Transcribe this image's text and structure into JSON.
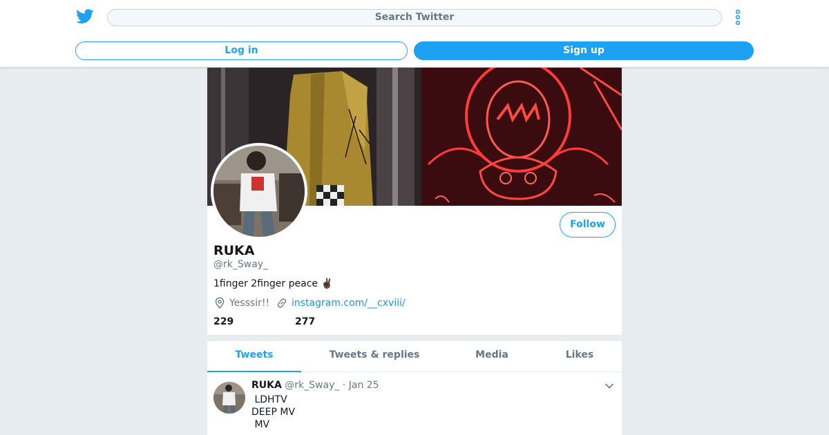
{
  "colors": {
    "accent": "#1da1f2",
    "link": "#1b95e0",
    "muted": "#657786",
    "background": "#e6ecf0"
  },
  "header": {
    "logo_icon": "twitter-bird-icon",
    "search_placeholder": "Search Twitter",
    "more_icon": "vertical-ellipsis-icon",
    "login_label": "Log in",
    "signup_label": "Sign up"
  },
  "profile": {
    "follow_label": "Follow",
    "name": "RUKA",
    "handle": "@rk_Sway_",
    "bio": "1finger 2finger peace ✌🏿",
    "location": "Yesssir!!",
    "location_icon": "location-pin-icon",
    "website": "instagram.com/__cxviii/",
    "link_icon": "link-icon",
    "stats": {
      "following": "229",
      "followers": "277"
    }
  },
  "tabs": [
    {
      "label": "Tweets",
      "active": true
    },
    {
      "label": "Tweets & replies",
      "active": false
    },
    {
      "label": "Media",
      "active": false
    },
    {
      "label": "Likes",
      "active": false
    }
  ],
  "tweet": {
    "name": "RUKA",
    "handle": "@rk_Sway_",
    "separator": "·",
    "date": "Jan 25",
    "menu_icon": "chevron-down-icon",
    "body": " LDHTV\nDEEP MV\n MV"
  }
}
